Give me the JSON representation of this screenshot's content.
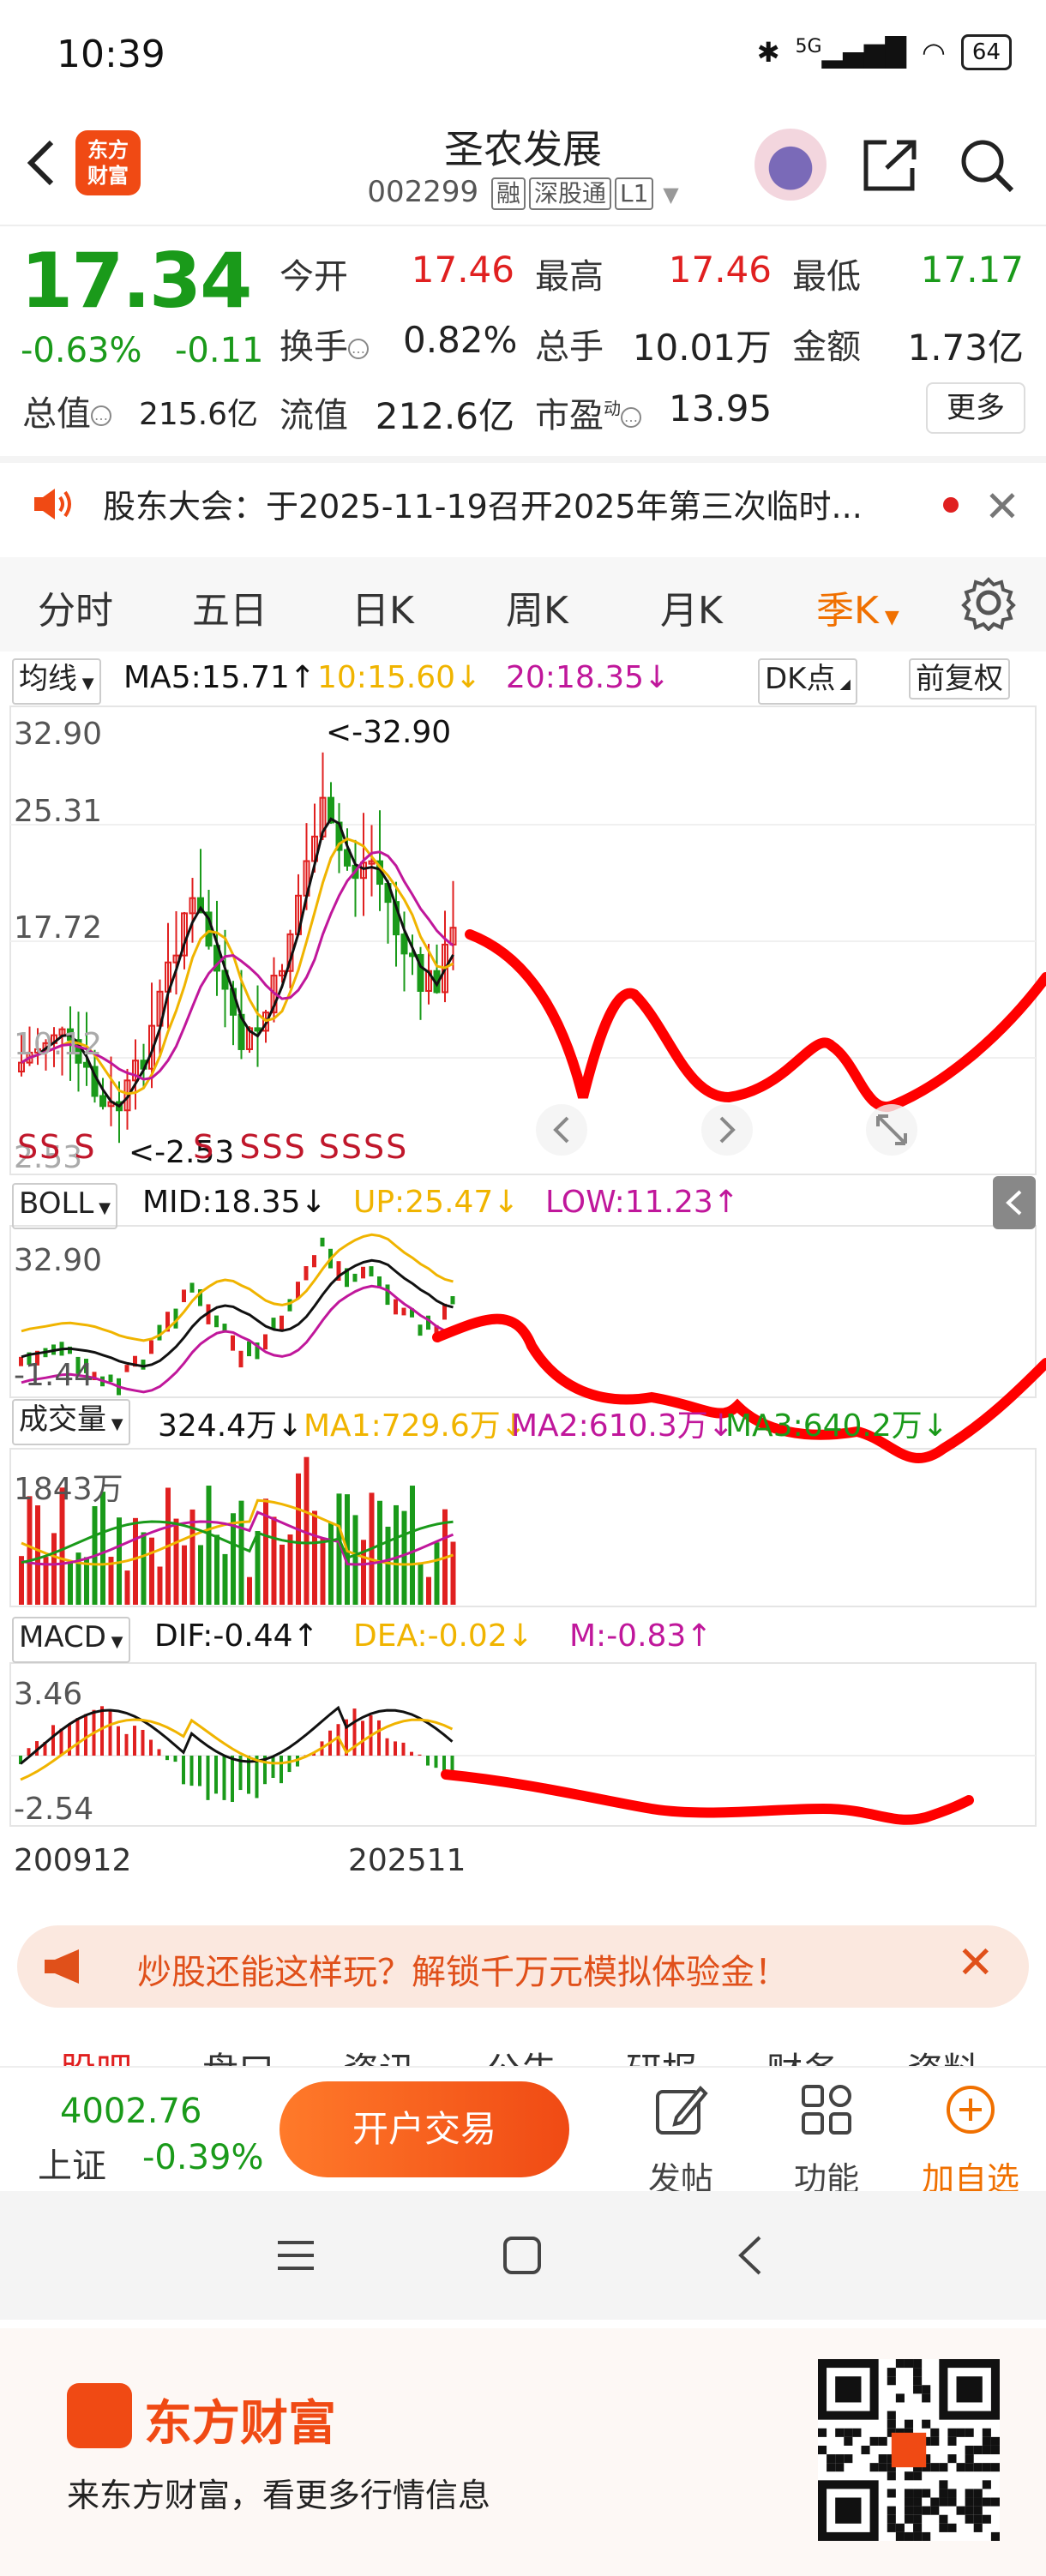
{
  "status_bar": {
    "time": "10:39",
    "battery": "64",
    "signal": "5G"
  },
  "header": {
    "stock_name": "圣农发展",
    "stock_code": "002299",
    "tags": [
      "融",
      "深股通",
      "L1"
    ],
    "logo_text_1": "东方",
    "logo_text_2": "财富"
  },
  "quote": {
    "price": "17.34",
    "change_pct": "-0.63%",
    "change_val": "-0.11",
    "open_label": "今开",
    "open": "17.46",
    "high_label": "最高",
    "high": "17.46",
    "low_label": "最低",
    "low": "17.17",
    "turnover_label": "换手",
    "turnover": "0.82%",
    "volume_label": "总手",
    "volume": "10.01万",
    "amount_label": "金额",
    "amount": "1.73亿",
    "total_cap_label": "总值",
    "total_cap": "215.6亿",
    "float_cap_label": "流值",
    "float_cap": "212.6亿",
    "pe_label": "市盈",
    "pe_sup": "动",
    "pe": "13.95",
    "more_label": "更多"
  },
  "notice": {
    "text": "股东大会：于2025-11-19召开2025年第三次临时..."
  },
  "period_tabs": [
    "分时",
    "五日",
    "日K",
    "周K",
    "月K",
    "季K"
  ],
  "chart": {
    "ma_selector": "均线",
    "ma5": "MA5:15.71",
    "ma10": "10:15.60",
    "ma20": "20:18.35",
    "dk_label": "DK点",
    "adjust_label": "前复权",
    "price_ticks": [
      "32.90",
      "25.31",
      "17.72",
      "10.12",
      "2.53"
    ],
    "max_marker": "<-32.90",
    "min_marker": "<-2.53",
    "boll_selector": "BOLL",
    "boll_mid": "MID:18.35",
    "boll_up": "UP:25.47",
    "boll_low": "LOW:11.23",
    "boll_ticks": [
      "32.90",
      "-1.44"
    ],
    "vol_selector": "成交量",
    "vol_value": "324.4万",
    "vol_ma1": "MA1:729.6万",
    "vol_ma2": "MA2:610.3万",
    "vol_ma3": "MA3:640.2万",
    "vol_tick": "1843万",
    "macd_selector": "MACD",
    "macd_dif": "DIF:-0.44",
    "macd_dea": "DEA:-0.02",
    "macd_m": "M:-0.83",
    "macd_ticks": [
      "3.46",
      "-2.54"
    ],
    "date_start": "200912",
    "date_end": "202511",
    "colors": {
      "up": "#e02020",
      "down": "#1a9a1a",
      "ma5": "#111111",
      "ma10": "#f0b400",
      "ma20": "#c0179b",
      "drawn": "#ff0000"
    }
  },
  "promo": {
    "text": "炒股还能这样玩？解锁千万元模拟体验金！"
  },
  "sub_tabs": [
    "股吧",
    "盘口",
    "资讯",
    "公告",
    "研报",
    "财务",
    "资料"
  ],
  "trade_bar": {
    "index_value": "4002.76",
    "index_name": "上证",
    "index_change": "-0.39%",
    "open_account": "开户交易",
    "post": "发帖",
    "functions": "功能",
    "add_watch": "加自选"
  },
  "footer": {
    "brand": "东方财富",
    "slogan": "来东方财富，看更多行情信息"
  }
}
